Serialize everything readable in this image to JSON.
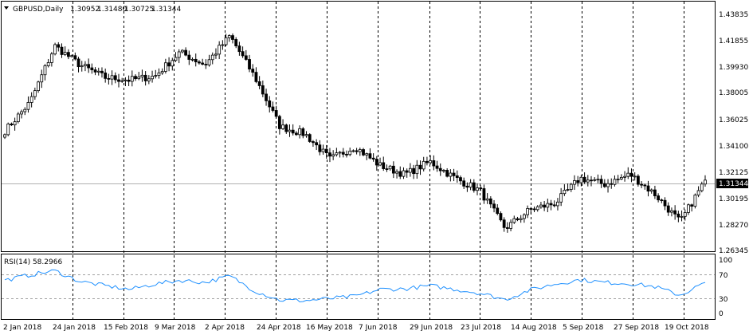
{
  "window": {
    "symbol_header": "GBPUSD,Daily",
    "ohlc": {
      "open": "1.30952",
      "high": "1.31480",
      "low": "1.30725",
      "close": "1.31344"
    },
    "menu_icon": "triangle-down-icon"
  },
  "price_axis": {
    "ticks": [
      "1.43835",
      "1.41855",
      "1.39930",
      "1.38005",
      "1.36025",
      "1.34100",
      "1.32125",
      "1.30195",
      "1.28270",
      "1.26345"
    ],
    "current_price": "1.31344",
    "ylim": [
      1.2575,
      1.4445
    ]
  },
  "rsi": {
    "label": "RSI(14) 58.2966",
    "ticks": [
      "100",
      "70",
      "30",
      "0"
    ],
    "levels": [
      70,
      30
    ],
    "ylim": [
      0,
      100
    ]
  },
  "time_axis": {
    "labels": [
      "2 Jan 2018",
      "24 Jan 2018",
      "15 Feb 2018",
      "9 Mar 2018",
      "2 Apr 2018",
      "24 Apr 2018",
      "16 May 2018",
      "7 Jun 2018",
      "29 Jun 2018",
      "23 Jul 2018",
      "14 Aug 2018",
      "5 Sep 2018",
      "27 Sep 2018",
      "19 Oct 2018"
    ],
    "separators": [
      "24 Jan 2018",
      "15 Feb 2018",
      "9 Mar 2018",
      "2 Apr 2018",
      "24 Apr 2018",
      "16 May 2018",
      "7 Jun 2018",
      "29 Jun 2018",
      "23 Jul 2018",
      "14 Aug 2018",
      "5 Sep 2018",
      "27 Sep 2018",
      "19 Oct 2018"
    ]
  },
  "colors": {
    "background": "#ffffff",
    "candle_up": "#ffffff",
    "candle_down": "#000000",
    "grid_separator": "#000000",
    "rsi_line": "#1e90ff",
    "rsi_levels": "#a0a0a0",
    "current_price_line": "#b0b0b0",
    "price_box": "#000000",
    "price_box_text": "#ffffff"
  },
  "chart_data": [
    {
      "type": "candlestick",
      "title": "GBPUSD,Daily",
      "x": [
        "2 Jan 2018",
        "11 Jan 2018",
        "24 Jan 2018",
        "5 Feb 2018",
        "15 Feb 2018",
        "27 Feb 2018",
        "9 Mar 2018",
        "21 Mar 2018",
        "2 Apr 2018",
        "12 Apr 2018",
        "24 Apr 2018",
        "4 May 2018",
        "16 May 2018",
        "28 May 2018",
        "7 Jun 2018",
        "19 Jun 2018",
        "29 Jun 2018",
        "11 Jul 2018",
        "23 Jul 2018",
        "2 Aug 2018",
        "14 Aug 2018",
        "24 Aug 2018",
        "5 Sep 2018",
        "17 Sep 2018",
        "27 Sep 2018",
        "9 Oct 2018",
        "19 Oct 2018",
        "26 Oct 2018",
        "31 Oct 2018"
      ],
      "close": [
        1.3525,
        1.375,
        1.42,
        1.405,
        1.395,
        1.393,
        1.396,
        1.415,
        1.405,
        1.428,
        1.395,
        1.356,
        1.35,
        1.33,
        1.34,
        1.325,
        1.318,
        1.328,
        1.315,
        1.305,
        1.275,
        1.29,
        1.295,
        1.315,
        1.31,
        1.318,
        1.302,
        1.28,
        1.3134
      ],
      "ylim": [
        1.2575,
        1.4445
      ]
    },
    {
      "type": "line",
      "title": "RSI(14) 58.2966",
      "x": [
        "2 Jan 2018",
        "11 Jan 2018",
        "24 Jan 2018",
        "5 Feb 2018",
        "15 Feb 2018",
        "27 Feb 2018",
        "9 Mar 2018",
        "21 Mar 2018",
        "2 Apr 2018",
        "12 Apr 2018",
        "24 Apr 2018",
        "4 May 2018",
        "16 May 2018",
        "28 May 2018",
        "7 Jun 2018",
        "19 Jun 2018",
        "29 Jun 2018",
        "11 Jul 2018",
        "23 Jul 2018",
        "2 Aug 2018",
        "14 Aug 2018",
        "24 Aug 2018",
        "5 Sep 2018",
        "17 Sep 2018",
        "27 Sep 2018",
        "9 Oct 2018",
        "19 Oct 2018",
        "26 Oct 2018",
        "31 Oct 2018"
      ],
      "values": [
        62,
        72,
        80,
        60,
        52,
        45,
        55,
        62,
        58,
        70,
        42,
        25,
        24,
        28,
        32,
        45,
        46,
        52,
        45,
        38,
        26,
        44,
        55,
        63,
        58,
        56,
        50,
        34,
        58
      ],
      "ylim": [
        0,
        100
      ]
    }
  ]
}
